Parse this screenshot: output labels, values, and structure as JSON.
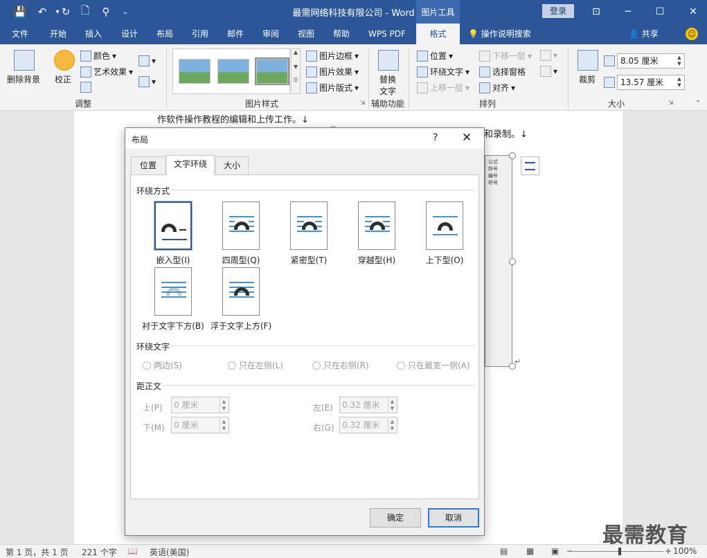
{
  "window": {
    "title": "最需网络科技有限公司 - Word",
    "context_tool": "图片工具",
    "login": "登录"
  },
  "tabs": [
    "文件",
    "开始",
    "插入",
    "设计",
    "布局",
    "引用",
    "邮件",
    "审阅",
    "视图",
    "帮助",
    "WPS PDF",
    "格式"
  ],
  "active_tab": "格式",
  "tell_me": "操作说明搜索",
  "share": "共享",
  "ribbon": {
    "adjust": {
      "remove_bg": "删除背景",
      "correct": "校正",
      "color": "颜色",
      "artistic": "艺术效果",
      "label": "调整"
    },
    "styles": {
      "border": "图片边框",
      "effects": "图片效果",
      "layout": "图片版式",
      "label": "图片样式"
    },
    "assist": {
      "alt_text_l1": "替换",
      "alt_text_l2": "文字",
      "label": "辅助功能"
    },
    "arrange": {
      "position": "位置",
      "wrap_text": "环绕文字",
      "bring_forward": "上移一层",
      "send_backward": "下移一层",
      "selection_pane": "选择窗格",
      "align": "对齐",
      "label": "排列"
    },
    "size": {
      "crop": "裁剪",
      "height": "8.05 厘米",
      "width": "13.57 厘米",
      "label": "大小"
    }
  },
  "document": {
    "line1": "作软件操作教程的编辑和上传工作。↓",
    "line2": "和录制。↓",
    "mini_labels": [
      "公式",
      "符号",
      "编号",
      "符号"
    ],
    "para_mark": "↵"
  },
  "dialog": {
    "title": "布局",
    "help": "?",
    "close": "✕",
    "tabs": [
      "位置",
      "文字环绕",
      "大小"
    ],
    "active_tab": "文字环绕",
    "wrap_style_title": "环绕方式",
    "wrap_styles": [
      "嵌入型(I)",
      "四周型(Q)",
      "紧密型(T)",
      "穿越型(H)",
      "上下型(O)",
      "衬于文字下方(B)",
      "浮于文字上方(F)"
    ],
    "selected_wrap": "嵌入型(I)",
    "wrap_text_title": "环绕文字",
    "wrap_text_options": [
      "两边(S)",
      "只在左侧(L)",
      "只在右侧(R)",
      "只在最宽一侧(A)"
    ],
    "distance_title": "距正文",
    "distance": {
      "top_label": "上(P)",
      "top_value": "0 厘米",
      "bottom_label": "下(M)",
      "bottom_value": "0 厘米",
      "left_label": "左(E)",
      "left_value": "0.32 厘米",
      "right_label": "右(G)",
      "right_value": "0.32 厘米"
    },
    "ok": "确定",
    "cancel": "取消"
  },
  "status": {
    "page": "第 1 页，共 1 页",
    "words": "221 个字",
    "language": "英语(美国)",
    "zoom": "100%"
  },
  "watermark": "最需教育"
}
